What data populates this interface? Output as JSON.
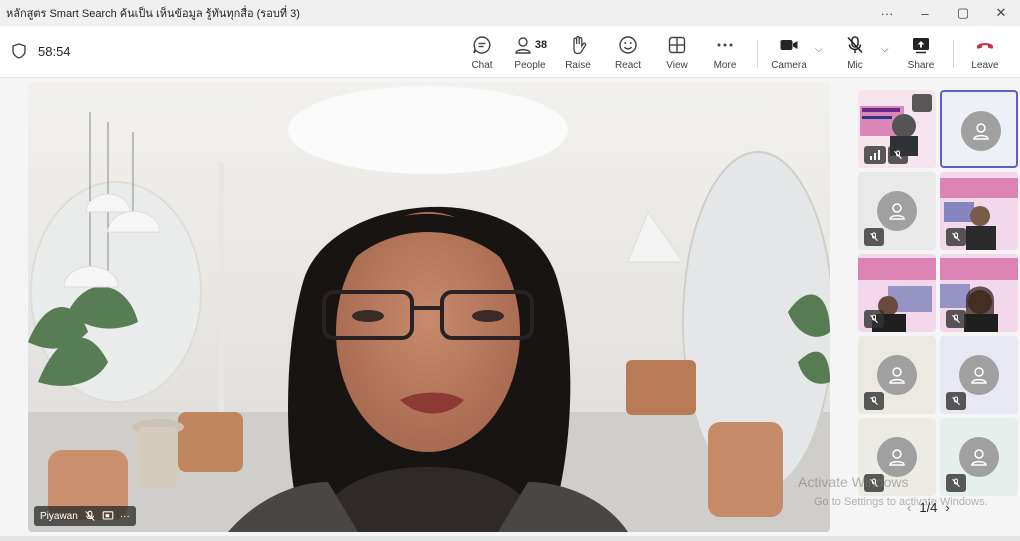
{
  "window": {
    "title": "หลักสูตร Smart Search ค้นเป็น เห็นข้อมูล รู้ทันทุกสื่อ (รอบที่ 3)",
    "controls": [
      "···",
      "–",
      "▢",
      "✕"
    ]
  },
  "toolbar": {
    "timer": "58:54",
    "chat_label": "Chat",
    "people_label": "People",
    "people_count": "38",
    "raise_label": "Raise",
    "react_label": "React",
    "view_label": "View",
    "more_label": "More",
    "camera_label": "Camera",
    "mic_label": "Mic",
    "share_label": "Share",
    "leave_label": "Leave"
  },
  "stage": {
    "participant_name": "Piyawan",
    "more_glyph": "···"
  },
  "gallery": {
    "page": "1/4",
    "prev": "‹",
    "next": "›"
  },
  "watermark": {
    "line1": "Activate Windows",
    "line2": "Go to Settings to activate Windows."
  },
  "colors": {
    "leave": "#c4314b",
    "active_border": "#5b5fc7"
  }
}
